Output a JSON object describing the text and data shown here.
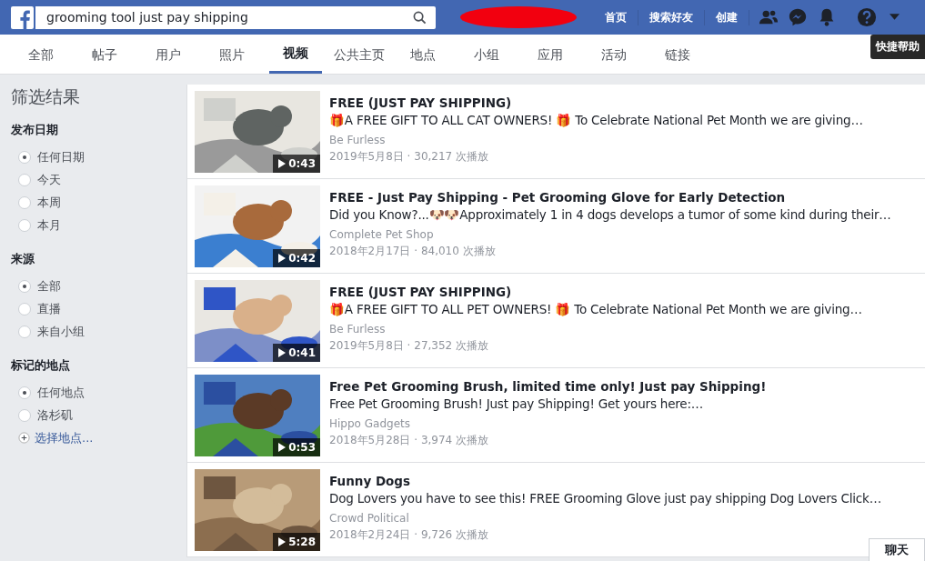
{
  "header": {
    "search": {
      "value": "grooming tool just pay shipping"
    },
    "nav": [
      "首页",
      "搜索好友",
      "创建"
    ],
    "tooltip": "快捷帮助"
  },
  "tabs": [
    {
      "label": "全部",
      "selected": false
    },
    {
      "label": "帖子",
      "selected": false
    },
    {
      "label": "用户",
      "selected": false
    },
    {
      "label": "照片",
      "selected": false
    },
    {
      "label": "视频",
      "selected": true
    },
    {
      "label": "公共主页",
      "selected": false
    },
    {
      "label": "地点",
      "selected": false
    },
    {
      "label": "小组",
      "selected": false
    },
    {
      "label": "应用",
      "selected": false
    },
    {
      "label": "活动",
      "selected": false
    },
    {
      "label": "链接",
      "selected": false
    }
  ],
  "sidebar": {
    "title": "筛选结果",
    "groups": [
      {
        "heading": "发布日期",
        "options": [
          {
            "label": "任何日期",
            "selected": true
          },
          {
            "label": "今天",
            "selected": false
          },
          {
            "label": "本周",
            "selected": false
          },
          {
            "label": "本月",
            "selected": false
          }
        ]
      },
      {
        "heading": "来源",
        "options": [
          {
            "label": "全部",
            "selected": true
          },
          {
            "label": "直播",
            "selected": false
          },
          {
            "label": "来自小组",
            "selected": false
          }
        ]
      },
      {
        "heading": "标记的地点",
        "options": [
          {
            "label": "任何地点",
            "selected": true
          },
          {
            "label": "洛杉矶",
            "selected": false
          }
        ],
        "add_link": "选择地点..."
      }
    ]
  },
  "results": [
    {
      "title": "FREE (JUST PAY SHIPPING)",
      "description": "🎁A FREE GIFT TO ALL CAT OWNERS! 🎁 To Celebrate National Pet Month we are giving…",
      "source": "Be Furless",
      "meta": "2019年5月8日 · 30,217 次播放",
      "duration": "0:43",
      "kind": "picture"
    },
    {
      "title": "FREE - Just Pay Shipping - Pet Grooming Glove for Early Detection",
      "description": "Did you Know?...🐶🐶Approximately 1 in 4 dogs develops a tumor of some kind during their…",
      "source": "Complete Pet Shop",
      "meta": "2018年2月17日 · 84,010 次播放",
      "duration": "0:42",
      "kind": "picture"
    },
    {
      "title": "FREE (JUST PAY SHIPPING)",
      "description": "🎁A FREE GIFT TO ALL PET OWNERS! 🎁 To Celebrate National Pet Month we are giving…",
      "source": "Be Furless",
      "meta": "2019年5月8日 · 27,352 次播放",
      "duration": "0:41",
      "kind": "picture"
    },
    {
      "title": "Free Pet Grooming Brush, limited time only! Just pay Shipping!",
      "description": "Free Pet Grooming Brush! Just pay Shipping! Get yours here:…",
      "source": "Hippo Gadgets",
      "meta": "2018年5月28日 · 3,974 次播放",
      "duration": "0:53",
      "kind": "picture"
    },
    {
      "title": "Funny Dogs",
      "description": "Dog Lovers you have to see this! FREE Grooming Glove just pay shipping Dog Lovers Click…",
      "source": "Crowd Political",
      "meta": "2018年2月24日 · 9,726 次播放",
      "duration": "5:28",
      "kind": "picture"
    }
  ],
  "chat": "聊天"
}
